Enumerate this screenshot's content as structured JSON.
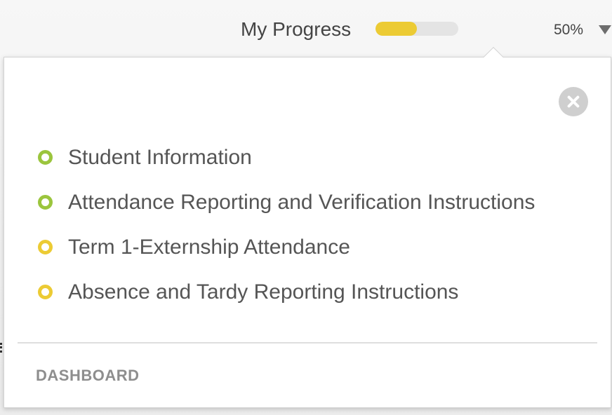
{
  "progress": {
    "title": "My Progress",
    "percent_label": "50%",
    "fraction": 0.5,
    "bar_color": "#eccb34",
    "track_color": "#e4e4e4"
  },
  "dropdown": {
    "icon": "triangle-down-icon"
  },
  "panel": {
    "close_icon": "close-icon",
    "lessons": [
      {
        "label": "Student Information",
        "status": "complete",
        "color": "#9bc53d"
      },
      {
        "label": "Attendance Reporting and Verification Instructions",
        "status": "complete",
        "color": "#9bc53d"
      },
      {
        "label": "Term 1-Externship Attendance",
        "status": "in-progress",
        "color": "#eccb34"
      },
      {
        "label": "Absence and Tardy Reporting Instructions",
        "status": "in-progress",
        "color": "#eccb34"
      }
    ],
    "dashboard_label": "DASHBOARD"
  }
}
